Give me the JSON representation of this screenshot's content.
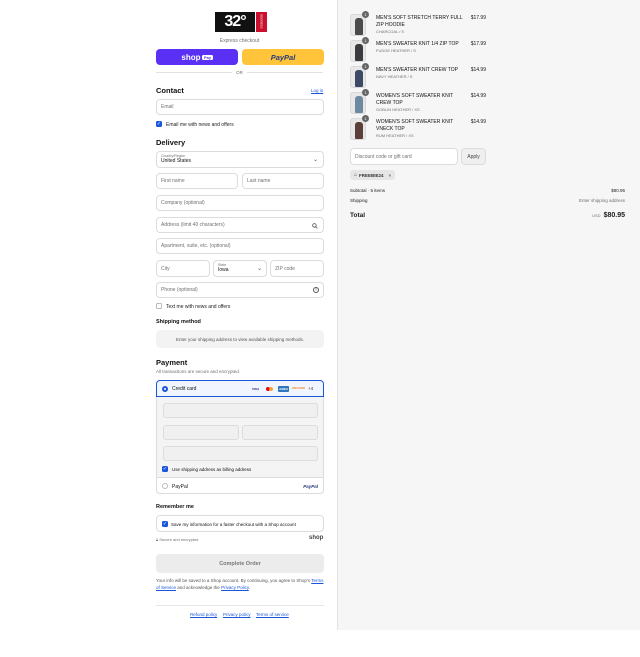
{
  "brand": {
    "logo_text": "32°",
    "logo_side": "DEGREES"
  },
  "express": {
    "label": "Express checkout",
    "shoppay_label": "shop",
    "shoppay_badge": "Pay",
    "paypal_label": "PayPal",
    "or_label": "OR"
  },
  "contact": {
    "title": "Contact",
    "login_label": "Log in",
    "email_placeholder": "Email",
    "email_news_label": "Email me with news and offers"
  },
  "delivery": {
    "title": "Delivery",
    "country_label": "Country/Region",
    "country_value": "United States",
    "first_name": "First name",
    "last_name": "Last name",
    "company": "Company (optional)",
    "address": "Address (limit 40 characters)",
    "apartment": "Apartment, suite, etc. (optional)",
    "city": "City",
    "state_label": "State",
    "state_value": "Iowa",
    "zip": "ZIP code",
    "phone": "Phone (optional)",
    "text_news_label": "Text me with news and offers"
  },
  "shipping": {
    "title": "Shipping method",
    "info": "Enter your shipping address to view available shipping methods."
  },
  "payment": {
    "title": "Payment",
    "subtitle": "All transactions are secure and encrypted.",
    "credit_card_label": "Credit card",
    "cards": [
      "VISA",
      "MC",
      "AMEX",
      "DISCOVER"
    ],
    "more_cards": "+4",
    "billing_label": "Use shipping address as billing address",
    "paypal_label": "PayPal",
    "paypal_logo": "PayPal"
  },
  "remember": {
    "title": "Remember me",
    "save_label": "Save my information for a faster checkout with a Shop account",
    "secure_label": "Secure and encrypted",
    "shop_logo": "shop"
  },
  "complete_button": "Complete Order",
  "disclaimer": {
    "text1": "Your info will be saved to a Shop account. By continuing, you agree to Shop's",
    "tos_link": "Terms of Service",
    "text2": "and acknowledge the",
    "privacy_link": "Privacy Policy",
    "text3": "."
  },
  "footer": {
    "refund": "Refund policy",
    "privacy": "Privacy policy",
    "terms": "Terms of service"
  },
  "items": [
    {
      "qty": "1",
      "name": "MEN'S SOFT STRETCH TERRY FULL ZIP HOODIE",
      "variant": "CHARCOAL / S",
      "price": "$17.99",
      "color": "#4a4a4a"
    },
    {
      "qty": "1",
      "name": "MEN'S SWEATER KNIT 1/4 ZIP TOP",
      "variant": "FUDGE HEATHER / S",
      "price": "$17.99",
      "color": "#3b3a3f"
    },
    {
      "qty": "1",
      "name": "MEN'S SWEATER KNIT CREW TOP",
      "variant": "NAVY HEATHER / S",
      "price": "$14.99",
      "color": "#3c4a66"
    },
    {
      "qty": "1",
      "name": "WOMEN'S SOFT SWEATER KNIT CREW TOP",
      "variant": "GOBLIN HEATHER / XS",
      "price": "$14.99",
      "color": "#6d8aa0"
    },
    {
      "qty": "1",
      "name": "WOMEN'S SOFT SWEATER KNIT VNECK TOP",
      "variant": "RUM HEATHER / XS",
      "price": "$14.99",
      "color": "#5a4038"
    }
  ],
  "discount": {
    "placeholder": "Discount code or gift card",
    "apply": "Apply",
    "tag": "FREEBIE24"
  },
  "summary": {
    "subtotal_label": "Subtotal · 5 items",
    "subtotal_value": "$80.95",
    "shipping_label": "Shipping",
    "shipping_value": "Enter shipping address",
    "total_label": "Total",
    "currency": "USD",
    "total_value": "$80.95"
  },
  "colors": {
    "shoppay": "#5a31f4",
    "paypal": "#ffc439",
    "accent": "#1a56db"
  }
}
